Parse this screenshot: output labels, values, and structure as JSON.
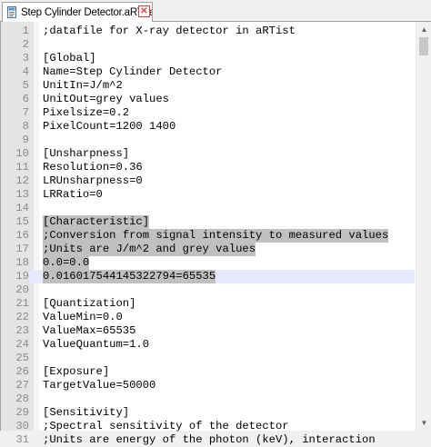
{
  "tab": {
    "title": "Step Cylinder Detector.aRTdet",
    "icon": "document-icon",
    "close_symbol": "✕"
  },
  "editor": {
    "current_line": 19,
    "selected_lines": [
      15,
      16,
      17,
      18,
      19
    ],
    "scroll_position": 0.0,
    "lines": [
      {
        "n": "1",
        "text": ";datafile for X-ray detector in aRTist"
      },
      {
        "n": "2",
        "text": ""
      },
      {
        "n": "3",
        "text": "[Global]"
      },
      {
        "n": "4",
        "text": "Name=Step Cylinder Detector"
      },
      {
        "n": "5",
        "text": "UnitIn=J/m^2"
      },
      {
        "n": "6",
        "text": "UnitOut=grey values"
      },
      {
        "n": "7",
        "text": "Pixelsize=0.2"
      },
      {
        "n": "8",
        "text": "PixelCount=1200 1400"
      },
      {
        "n": "9",
        "text": ""
      },
      {
        "n": "10",
        "text": "[Unsharpness]"
      },
      {
        "n": "11",
        "text": "Resolution=0.36"
      },
      {
        "n": "12",
        "text": "LRUnsharpness=0"
      },
      {
        "n": "13",
        "text": "LRRatio=0"
      },
      {
        "n": "14",
        "text": ""
      },
      {
        "n": "15",
        "text": "[Characteristic]"
      },
      {
        "n": "16",
        "text": ";Conversion from signal intensity to measured values"
      },
      {
        "n": "17",
        "text": ";Units are J/m^2 and grey values"
      },
      {
        "n": "18",
        "text": "0.0=0.0"
      },
      {
        "n": "19",
        "text": "0.016017544145322794=65535"
      },
      {
        "n": "20",
        "text": ""
      },
      {
        "n": "21",
        "text": "[Quantization]"
      },
      {
        "n": "22",
        "text": "ValueMin=0.0"
      },
      {
        "n": "23",
        "text": "ValueMax=65535"
      },
      {
        "n": "24",
        "text": "ValueQuantum=1.0"
      },
      {
        "n": "25",
        "text": ""
      },
      {
        "n": "26",
        "text": "[Exposure]"
      },
      {
        "n": "27",
        "text": "TargetValue=50000"
      },
      {
        "n": "28",
        "text": ""
      },
      {
        "n": "29",
        "text": "[Sensitivity]"
      },
      {
        "n": "30",
        "text": ";Spectral sensitivity of the detector"
      },
      {
        "n": "31",
        "text": ";Units are energy of the photon (keV), interaction"
      }
    ]
  },
  "scrollbar": {
    "up_icon": "▲",
    "down_icon": "▼"
  }
}
